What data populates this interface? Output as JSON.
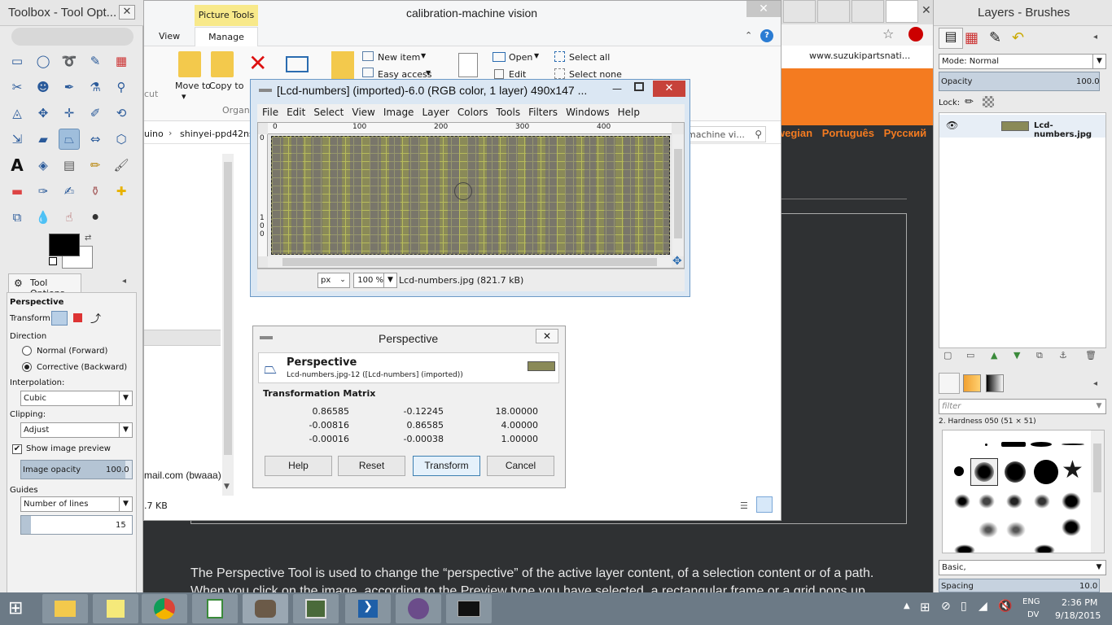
{
  "toolbox": {
    "title": "Toolbox - Tool Opt...",
    "tool_options_tab": "Tool Options",
    "tool_name": "Perspective",
    "transform_label": "Transform:",
    "direction_label": "Direction",
    "direction_options": [
      "Normal (Forward)",
      "Corrective (Backward)"
    ],
    "interpolation_label": "Interpolation:",
    "interpolation_value": "Cubic",
    "clipping_label": "Clipping:",
    "clipping_value": "Adjust",
    "show_preview_label": "Show image preview",
    "image_opacity_label": "Image opacity",
    "image_opacity_value": "100.0",
    "guides_label": "Guides",
    "guides_value": "Number of lines",
    "guides_count": "15"
  },
  "explorer": {
    "title": "calibration-machine vision",
    "picture_tools_tab": "Picture Tools",
    "tabs": [
      "View",
      "Manage"
    ],
    "ribbon": {
      "move_to": "Move to",
      "copy_to": "Copy to",
      "organise": "Organ",
      "cut": "cut",
      "new_item": "New item",
      "easy_access": "Easy access",
      "open": "Open",
      "edit": "Edit",
      "select_all": "Select all",
      "select_none": "Select none"
    },
    "breadcrumb": [
      "uino",
      "shinyei-ppd42ns"
    ],
    "search_placeholder": "machine vi...",
    "left_text": "mail.com (bwaaa)",
    "status_size": ".7 KB"
  },
  "image_window": {
    "title": "[Lcd-numbers] (imported)-6.0 (RGB color, 1 layer) 490x147 ...",
    "menu": [
      "File",
      "Edit",
      "Select",
      "View",
      "Image",
      "Layer",
      "Colors",
      "Tools",
      "Filters",
      "Windows",
      "Help"
    ],
    "ruler_ticks": [
      "0",
      "100",
      "200",
      "300",
      "400"
    ],
    "vruler_ticks": [
      "0",
      "1",
      "0",
      "0"
    ],
    "unit": "px",
    "zoom": "100 %",
    "status": "Lcd-numbers.jpg (821.7 kB)"
  },
  "perspective_dialog": {
    "title": "Perspective",
    "header": "Perspective",
    "subheader": "Lcd-numbers.jpg-12 ([Lcd-numbers] (imported))",
    "matrix_label": "Transformation Matrix",
    "matrix": [
      [
        "0.86585",
        "-0.12245",
        "18.00000"
      ],
      [
        "-0.00816",
        "0.86585",
        "4.00000"
      ],
      [
        "-0.00016",
        "-0.00038",
        "1.00000"
      ]
    ],
    "buttons": {
      "help": "Help",
      "reset": "Reset",
      "transform": "Transform",
      "cancel": "Cancel"
    }
  },
  "browser": {
    "url_fragment": "www.suzukipartsnati...",
    "languages": [
      "wegian",
      "Português",
      "Русский"
    ],
    "article_text_line1": "The Perspective Tool is used to change the “perspective” of the active layer content, of a selection content or of a path.",
    "article_text_line2": "When you click on the image, according to the Preview type you have selected, a rectangular frame or a grid pops up"
  },
  "layers_panel": {
    "title": "Layers - Brushes",
    "mode_label": "Mode: Normal",
    "opacity_label": "Opacity",
    "opacity_value": "100.0",
    "lock_label": "Lock:",
    "layer_name": "Lcd-numbers.jpg",
    "filter_placeholder": "filter",
    "brush_name": "2. Hardness 050 (51 × 51)",
    "brush_category": "Basic,",
    "spacing_label": "Spacing",
    "spacing_value": "10.0"
  },
  "taskbar": {
    "language": "ENG",
    "layout": "DV",
    "time": "2:36 PM",
    "date": "9/18/2015"
  },
  "colors": {
    "accent_orange": "#f47b20",
    "taskbar": "#6c7a86",
    "selection_blue": "#9fbedc"
  }
}
